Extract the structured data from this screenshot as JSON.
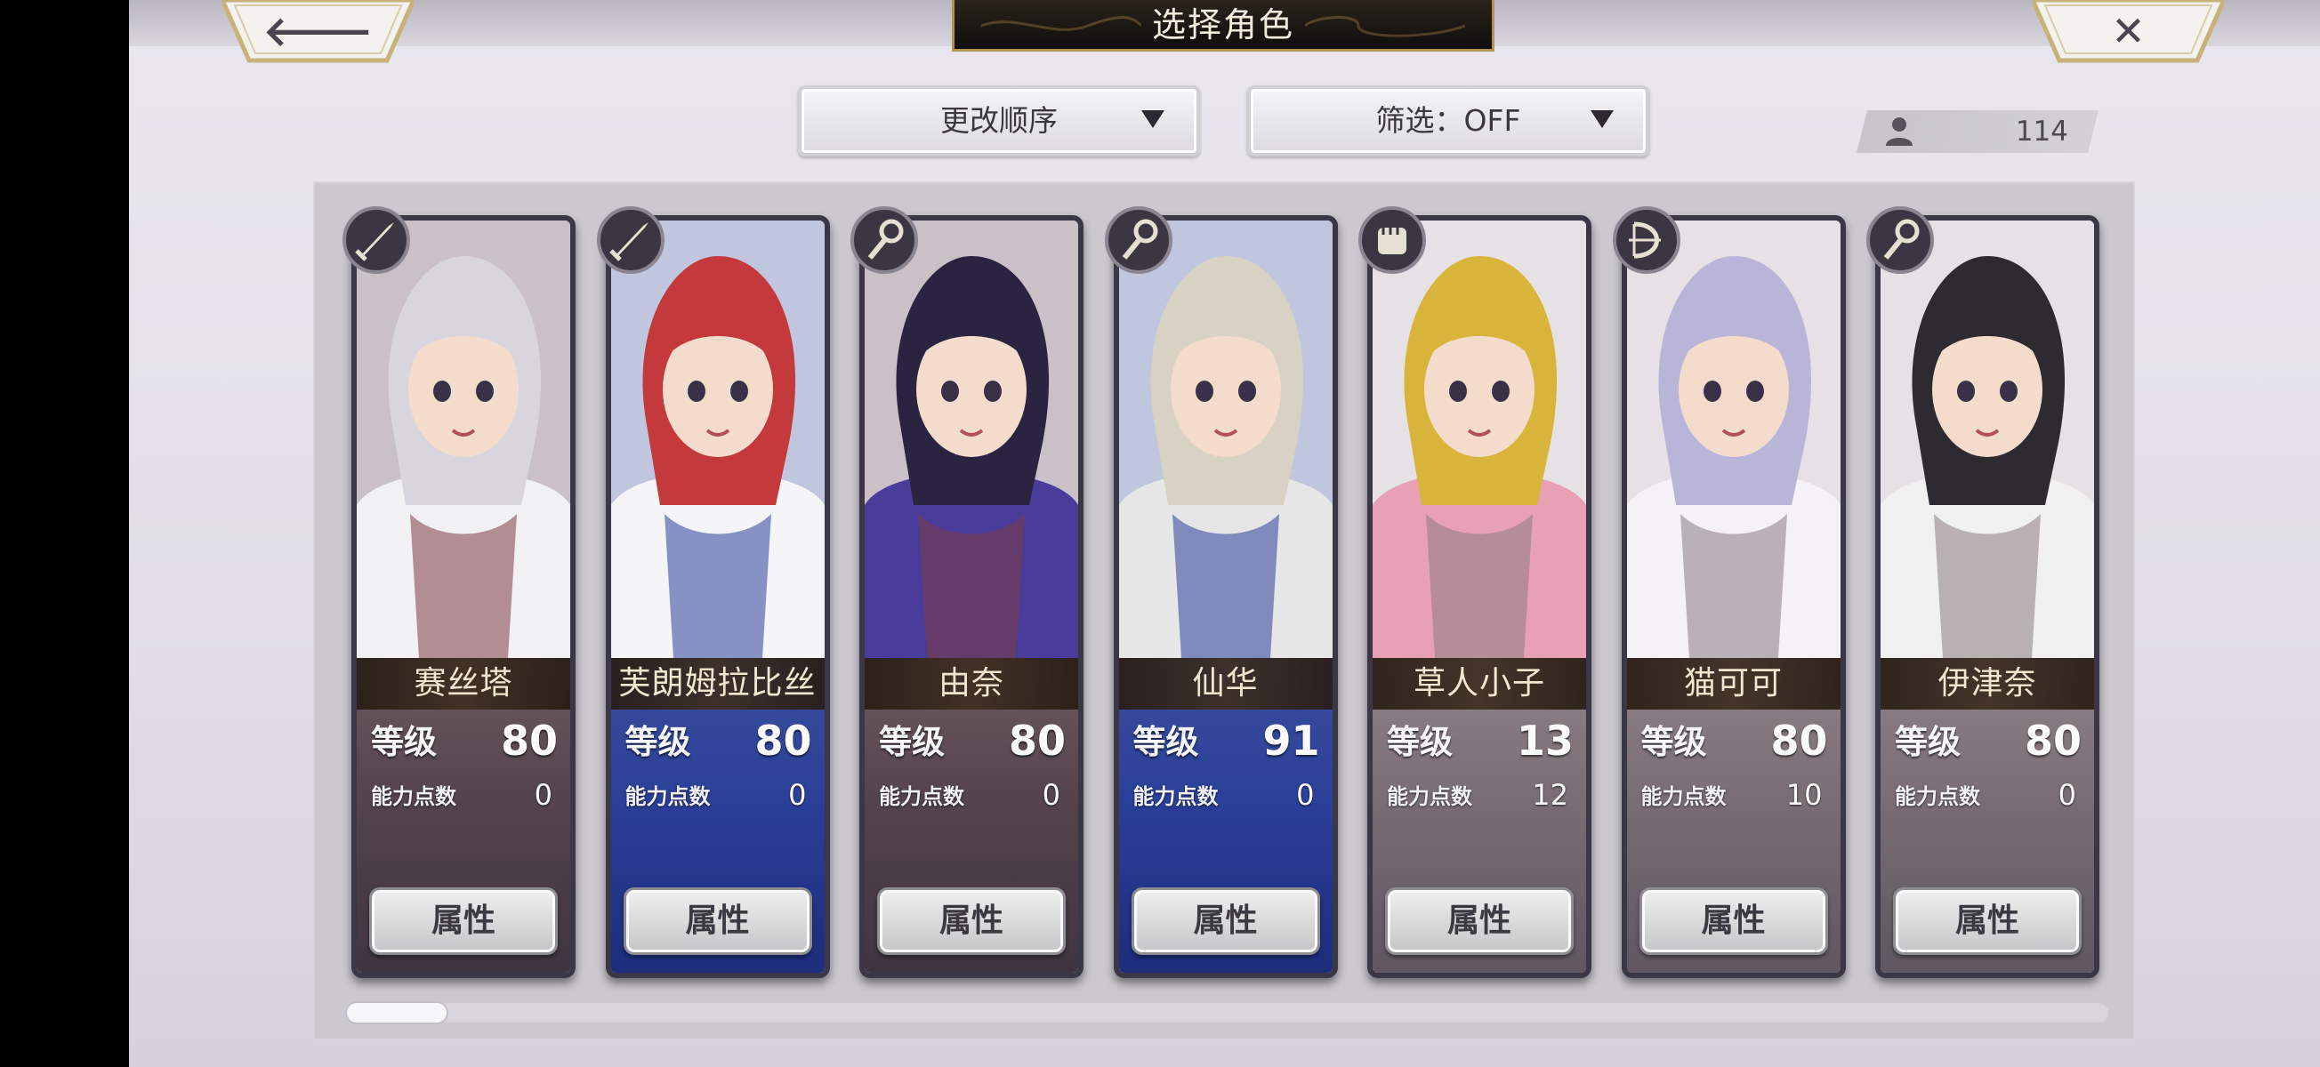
{
  "header": {
    "title": "选择角色",
    "back_icon": "arrow-left-icon",
    "close_icon": "close-icon"
  },
  "controls": {
    "sort_label": "更改顺序",
    "filter_label": "筛选：OFF",
    "character_count": "114",
    "count_icon": "person-icon"
  },
  "stat_labels": {
    "level": "等级",
    "ability_points": "能力点数",
    "attributes_button": "属性"
  },
  "characters": [
    {
      "name": "赛丝塔",
      "level": "80",
      "ability_points": "0",
      "class_icon": "sword-icon",
      "theme": "dark"
    },
    {
      "name": "芙朗姆拉比丝",
      "level": "80",
      "ability_points": "0",
      "class_icon": "sword-icon",
      "theme": "blue"
    },
    {
      "name": "由奈",
      "level": "80",
      "ability_points": "0",
      "class_icon": "staff-icon",
      "theme": "dark"
    },
    {
      "name": "仙华",
      "level": "91",
      "ability_points": "0",
      "class_icon": "staff-icon",
      "theme": "blue"
    },
    {
      "name": "草人小子",
      "level": "13",
      "ability_points": "12",
      "class_icon": "fist-icon",
      "theme": "light"
    },
    {
      "name": "猫可可",
      "level": "80",
      "ability_points": "10",
      "class_icon": "bow-icon",
      "theme": "light"
    },
    {
      "name": "伊津奈",
      "level": "80",
      "ability_points": "0",
      "class_icon": "staff-icon",
      "theme": "light"
    }
  ],
  "colors": {
    "panel": "#cbc8d0",
    "title_plate": "#1b1612",
    "title_border": "#b5924f",
    "card_border": "#3a3846"
  }
}
